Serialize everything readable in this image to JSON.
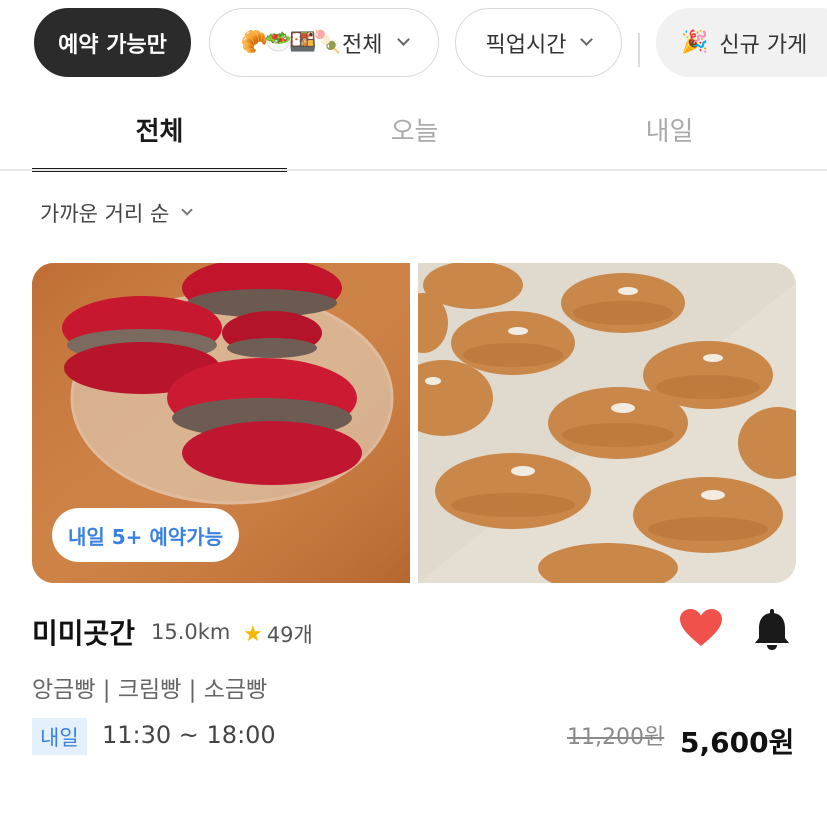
{
  "filters": {
    "available_only": "예약 가능만",
    "category_emoji": "🥐🥗🍱🍡",
    "category_label": "전체",
    "pickup_time": "픽업시간",
    "new_store_emoji": "🎉",
    "new_store_label": "신규 가게"
  },
  "tabs": [
    {
      "label": "전체",
      "active": true
    },
    {
      "label": "오늘",
      "active": false
    },
    {
      "label": "내일",
      "active": false
    }
  ],
  "sort": {
    "label": "가까운 거리 순"
  },
  "store": {
    "availability_badge": "내일 5+ 예약가능",
    "name": "미미곳간",
    "distance": "15.0km",
    "rating_count": "49개",
    "menu": "앙금빵 | 크림빵 | 소금빵",
    "pickup_day": "내일",
    "pickup_time": "11:30 ~ 18:00",
    "original_price": "11,200원",
    "price": "5,600원",
    "favorited": true
  },
  "colors": {
    "accent_blue": "#3b82e0",
    "heart_red": "#f0524b",
    "dark_chip": "#2b2b2b"
  }
}
